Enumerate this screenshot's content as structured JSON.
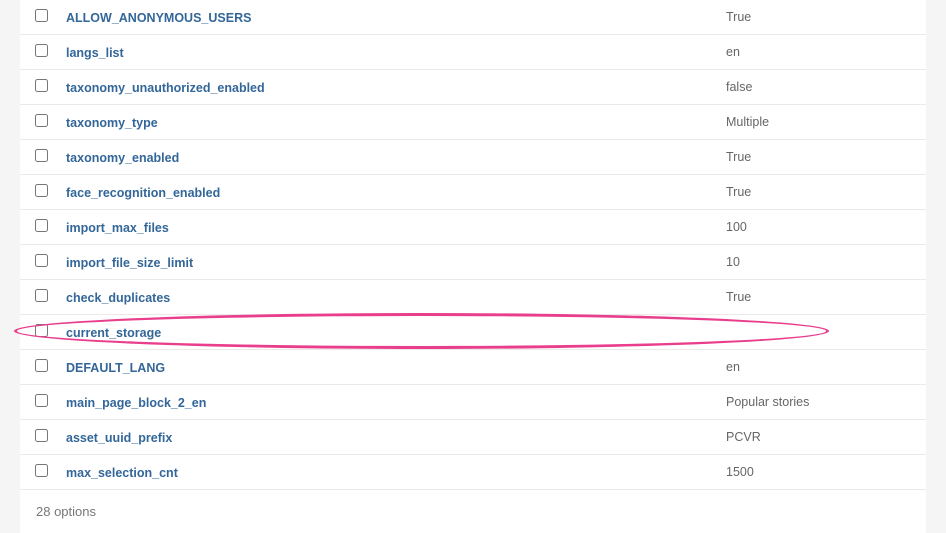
{
  "options": [
    {
      "key": "ALLOW_ANONYMOUS_USERS",
      "value": "True"
    },
    {
      "key": "langs_list",
      "value": "en"
    },
    {
      "key": "taxonomy_unauthorized_enabled",
      "value": "false"
    },
    {
      "key": "taxonomy_type",
      "value": "Multiple"
    },
    {
      "key": "taxonomy_enabled",
      "value": "True"
    },
    {
      "key": "face_recognition_enabled",
      "value": "True"
    },
    {
      "key": "import_max_files",
      "value": "100"
    },
    {
      "key": "import_file_size_limit",
      "value": "10"
    },
    {
      "key": "check_duplicates",
      "value": "True"
    },
    {
      "key": "current_storage",
      "value": ""
    },
    {
      "key": "DEFAULT_LANG",
      "value": "en"
    },
    {
      "key": "main_page_block_2_en",
      "value": "Popular stories"
    },
    {
      "key": "asset_uuid_prefix",
      "value": "PCVR"
    },
    {
      "key": "max_selection_cnt",
      "value": "1500"
    }
  ],
  "footer_text": "28 options",
  "highlight_index": 9
}
